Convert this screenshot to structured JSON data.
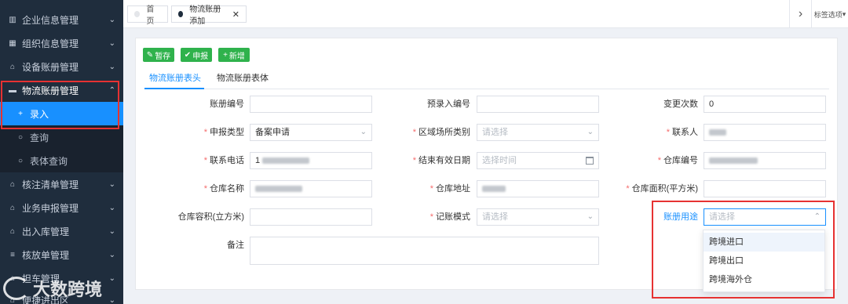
{
  "sidebar": {
    "items": [
      {
        "label": "企业信息管理",
        "icon": "building-icon",
        "glyph": "▥"
      },
      {
        "label": "组织信息管理",
        "icon": "org-icon",
        "glyph": "▦"
      },
      {
        "label": "设备账册管理",
        "icon": "home-icon",
        "glyph": "⌂"
      },
      {
        "label": "物流账册管理",
        "icon": "book-icon",
        "glyph": "▬"
      },
      {
        "label": "录入",
        "icon": "plus-icon",
        "glyph": "+"
      },
      {
        "label": "查询",
        "icon": "search-icon",
        "glyph": "○"
      },
      {
        "label": "表体查询",
        "icon": "search-icon",
        "glyph": "○"
      },
      {
        "label": "核注清单管理",
        "icon": "home-icon",
        "glyph": "⌂"
      },
      {
        "label": "业务申报管理",
        "icon": "home-icon",
        "glyph": "⌂"
      },
      {
        "label": "出入库管理",
        "icon": "home-icon",
        "glyph": "⌂"
      },
      {
        "label": "核放单管理",
        "icon": "list-icon",
        "glyph": "≡"
      },
      {
        "label": "担车管理",
        "icon": "home-icon",
        "glyph": "⌂"
      },
      {
        "label": "便捷进出区",
        "icon": "home-icon",
        "glyph": "⌂"
      }
    ]
  },
  "watermark": {
    "text": "大数跨境"
  },
  "tabs": [
    {
      "label": "首页"
    },
    {
      "label": "物流账册添加",
      "close": "✕"
    }
  ],
  "tabbar_right": {
    "arrow": "›",
    "options_label": "标签选项"
  },
  "toolbar": {
    "save_label": "暂存",
    "declare_label": "申报",
    "new_label": "新增",
    "save_glyph": "✎",
    "declare_glyph": "✔",
    "new_glyph": "+"
  },
  "subtabs": [
    "物流账册表头",
    "物流账册表体"
  ],
  "form": {
    "book_no": {
      "label": "账册编号",
      "value": ""
    },
    "pre_entry_no": {
      "label": "预录入编号",
      "value": ""
    },
    "change_count": {
      "label": "变更次数",
      "value": "0"
    },
    "declare_type": {
      "label": "申报类型",
      "value": "备案申请"
    },
    "area_type": {
      "label": "区域场所类别",
      "placeholder": "请选择"
    },
    "contact": {
      "label": "联系人"
    },
    "phone": {
      "label": "联系电话",
      "prefix": "1"
    },
    "end_date": {
      "label": "结束有效日期",
      "placeholder": "选择时间"
    },
    "warehouse_no": {
      "label": "仓库编号"
    },
    "warehouse_name": {
      "label": "仓库名称"
    },
    "warehouse_addr": {
      "label": "仓库地址"
    },
    "warehouse_area": {
      "label": "仓库面积(平方米)",
      "value": ""
    },
    "warehouse_volume": {
      "label": "仓库容积(立方米)",
      "value": ""
    },
    "account_mode": {
      "label": "记账模式",
      "placeholder": "请选择"
    },
    "book_usage": {
      "label": "账册用途",
      "placeholder": "请选择"
    },
    "remark": {
      "label": "备注"
    }
  },
  "dropdown": {
    "options": [
      "跨境进口",
      "跨境出口",
      "跨境海外仓"
    ]
  },
  "colors": {
    "sidebar_bg": "#1f2d3d",
    "active_blue": "#1890ff",
    "button_green": "#2fb24c",
    "required_red": "#f56c6c",
    "highlight_red": "#e63232"
  }
}
